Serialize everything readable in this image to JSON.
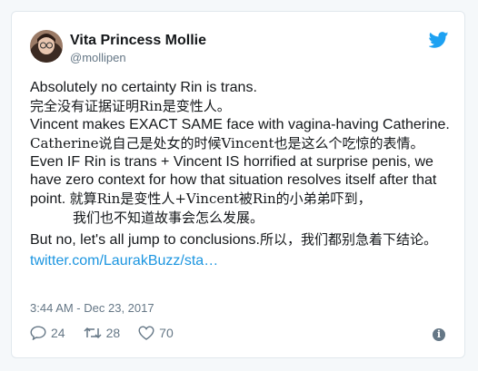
{
  "tweet": {
    "display_name": "Vita Princess Mollie",
    "handle": "@mollipen",
    "lines": {
      "l1": "Absolutely no certainty Rin is trans.",
      "l2": "完全没有证据证明Rin是变性人。",
      "l3": "Vincent makes EXACT SAME face with vagina-having Catherine.",
      "l4": "Catherine说自己是处女的时候Vincent也是这么个吃惊的表情。",
      "l5": "Even IF Rin is trans + Vincent IS horrified at surprise penis, we have zero context for how that situation resolves itself after that point.",
      "l5_cn_a": "就算Rin是变性人+Vincent被Rin的小弟弟吓到，",
      "l5_cn_b": "我们也不知道故事会怎么发展。",
      "l6": "But no, let's all jump to conclusions.",
      "l6_cn": "所以，我们都别急着下结论。",
      "link": "twitter.com/LaurakBuzz/sta…"
    },
    "timestamp": "3:44 AM - Dec 23, 2017",
    "stats": {
      "replies": "24",
      "retweets": "28",
      "likes": "70"
    }
  },
  "colors": {
    "link": "#1b95e0",
    "secondary_text": "#657786",
    "twitter_blue": "#1da1f2"
  },
  "icons": [
    "avatar",
    "twitter-bird-icon",
    "reply-icon",
    "retweet-icon",
    "like-icon",
    "info-icon"
  ]
}
